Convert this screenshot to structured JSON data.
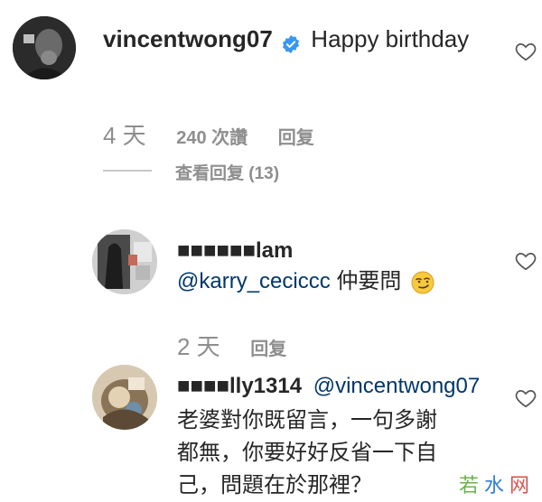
{
  "comments": [
    {
      "username": "vincentwong07",
      "text": "Happy birthday",
      "time": "4 天",
      "likes": "240 次讚",
      "reply": "回复",
      "view_replies": "查看回复 (13)",
      "verified": true
    },
    {
      "username": "■■■■■■lam",
      "mention": "@karry_ceciccc",
      "text": " 仲要問",
      "emoji": "smirking-face-emoji",
      "time": "2 天",
      "reply": "回复"
    },
    {
      "username": "■■■■lly1314",
      "mention": "@vincentwong07",
      "text_line1": "老婆對你既留言，一句多謝",
      "text_line2": "都無，你要好好反省一下自",
      "text_line3": "己，問題在於那裡？"
    }
  ],
  "watermark": {
    "c1": "若",
    "c2": "水",
    "c3": "网"
  },
  "colors": {
    "text": "#262626",
    "meta": "#8e8e8e",
    "mention": "#00376b",
    "verified": "#3897f0"
  },
  "icons": [
    "heart-outline-icon",
    "verified-badge-icon"
  ]
}
